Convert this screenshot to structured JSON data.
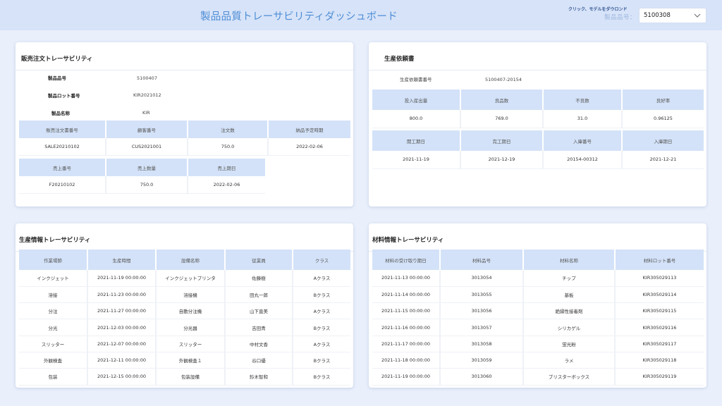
{
  "header": {
    "title": "製品品質トレーサビリティダッシュボード",
    "hint": "クリック、モデルをダウロンド",
    "product_label": "製品品号：",
    "product_value": "5100308"
  },
  "sales": {
    "title": "販売注文トレーサビリティ",
    "fields": [
      {
        "label": "製品品号",
        "value": "5100407"
      },
      {
        "label": "製品ロット番号",
        "value": "KIR2021012"
      },
      {
        "label": "製品名称",
        "value": "KIR"
      }
    ],
    "order_table": {
      "columns": [
        "販売注文書番号",
        "顧客番号",
        "注文数",
        "納品予定時期"
      ],
      "rows": [
        [
          "SALE20210102",
          "CUS2021001",
          "750.0",
          "2022-02-06"
        ]
      ]
    },
    "sale_table": {
      "columns": [
        "売上番号",
        "売上数量",
        "売上期日"
      ],
      "rows": [
        [
          "F20210102",
          "750.0",
          "2022-02-06"
        ]
      ]
    }
  },
  "request": {
    "title": "生産依頼書",
    "field": {
      "label": "生産依頼書番号",
      "value": "5100407-20154"
    },
    "qty_table": {
      "columns": [
        "投入産出量",
        "良品数",
        "不良数",
        "良好率"
      ],
      "rows": [
        [
          "800.0",
          "769.0",
          "31.0",
          "0.96125"
        ]
      ]
    },
    "date_table": {
      "columns": [
        "開工期日",
        "完工期日",
        "入庫番号",
        "入庫期日"
      ],
      "rows": [
        [
          "2021-11-19",
          "2021-12-19",
          "20154-00312",
          "2021-12-21"
        ]
      ]
    }
  },
  "production": {
    "title": "生産情報トレーサビリティ",
    "columns": [
      "作業場節",
      "生産時間",
      "設備名称",
      "従業員",
      "クラス"
    ],
    "rows": [
      [
        "インクジェット",
        "2021-11-19 00:00:00",
        "インクジェットプリンタ",
        "佐藤樹",
        "Aクラス"
      ],
      [
        "溶接",
        "2021-11-23 00:00:00",
        "溶接機",
        "田丸一郎",
        "Bクラス"
      ],
      [
        "分注",
        "2021-11-27 00:00:00",
        "自動分注機",
        "山下直美",
        "Aクラス"
      ],
      [
        "分光",
        "2021-12-03 00:00:00",
        "分光器",
        "吉田青",
        "Bクラス"
      ],
      [
        "スリッター",
        "2021-12-07 00:00:00",
        "スリッター",
        "中村文香",
        "Aクラス"
      ],
      [
        "外観検査",
        "2021-12-11 00:00:00",
        "外観検査１",
        "谷口優",
        "Bクラス"
      ],
      [
        "包装",
        "2021-12-15 00:00:00",
        "包装設備",
        "鈴木智和",
        "Bクラス"
      ]
    ]
  },
  "material": {
    "title": "材料情報トレーサビリティ",
    "columns": [
      "材料の受け取り期日",
      "材料品号",
      "材料名称",
      "材料ロット番号"
    ],
    "rows": [
      [
        "2021-11-13 00:00:00",
        "3013054",
        "チップ",
        "KIR305029113"
      ],
      [
        "2021-11-14 00:00:00",
        "3013055",
        "基板",
        "KIR305029114"
      ],
      [
        "2021-11-15 00:00:00",
        "3013056",
        "絶縁性接着剤",
        "KIR305029115"
      ],
      [
        "2021-11-16 00:00:00",
        "3013057",
        "シリカゲル",
        "KIR305029116"
      ],
      [
        "2021-11-17 00:00:00",
        "3013058",
        "蛍光粉",
        "KIR305029117"
      ],
      [
        "2021-11-18 00:00:00",
        "3013059",
        "ラメ",
        "KIR305029118"
      ],
      [
        "2021-11-19 00:00:00",
        "3013060",
        "ブリスターボックス",
        "KIR305029119"
      ]
    ]
  }
}
